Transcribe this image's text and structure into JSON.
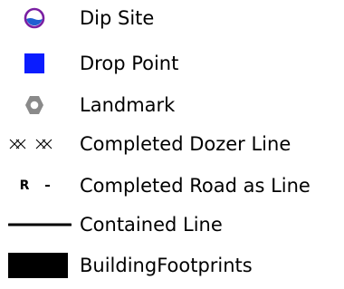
{
  "legend": {
    "items": [
      {
        "label": "Dip Site",
        "icon": "dip-site-icon"
      },
      {
        "label": "Drop Point",
        "icon": "drop-point-icon"
      },
      {
        "label": "Landmark",
        "icon": "landmark-icon"
      },
      {
        "label": "Completed Dozer Line",
        "icon": "dozer-line-icon"
      },
      {
        "label": "Completed Road as Line",
        "icon": "road-line-icon",
        "symbol_text": "R"
      },
      {
        "label": "Contained Line",
        "icon": "contained-line-icon"
      },
      {
        "label": "BuildingFootprints",
        "icon": "building-footprint-icon"
      }
    ],
    "colors": {
      "dip_site_outline": "#7a1fa2",
      "dip_site_water": "#1f5fd1",
      "drop_point": "#0a1cff",
      "landmark": "#8a8a8a",
      "line": "#000000",
      "building": "#000000"
    }
  }
}
